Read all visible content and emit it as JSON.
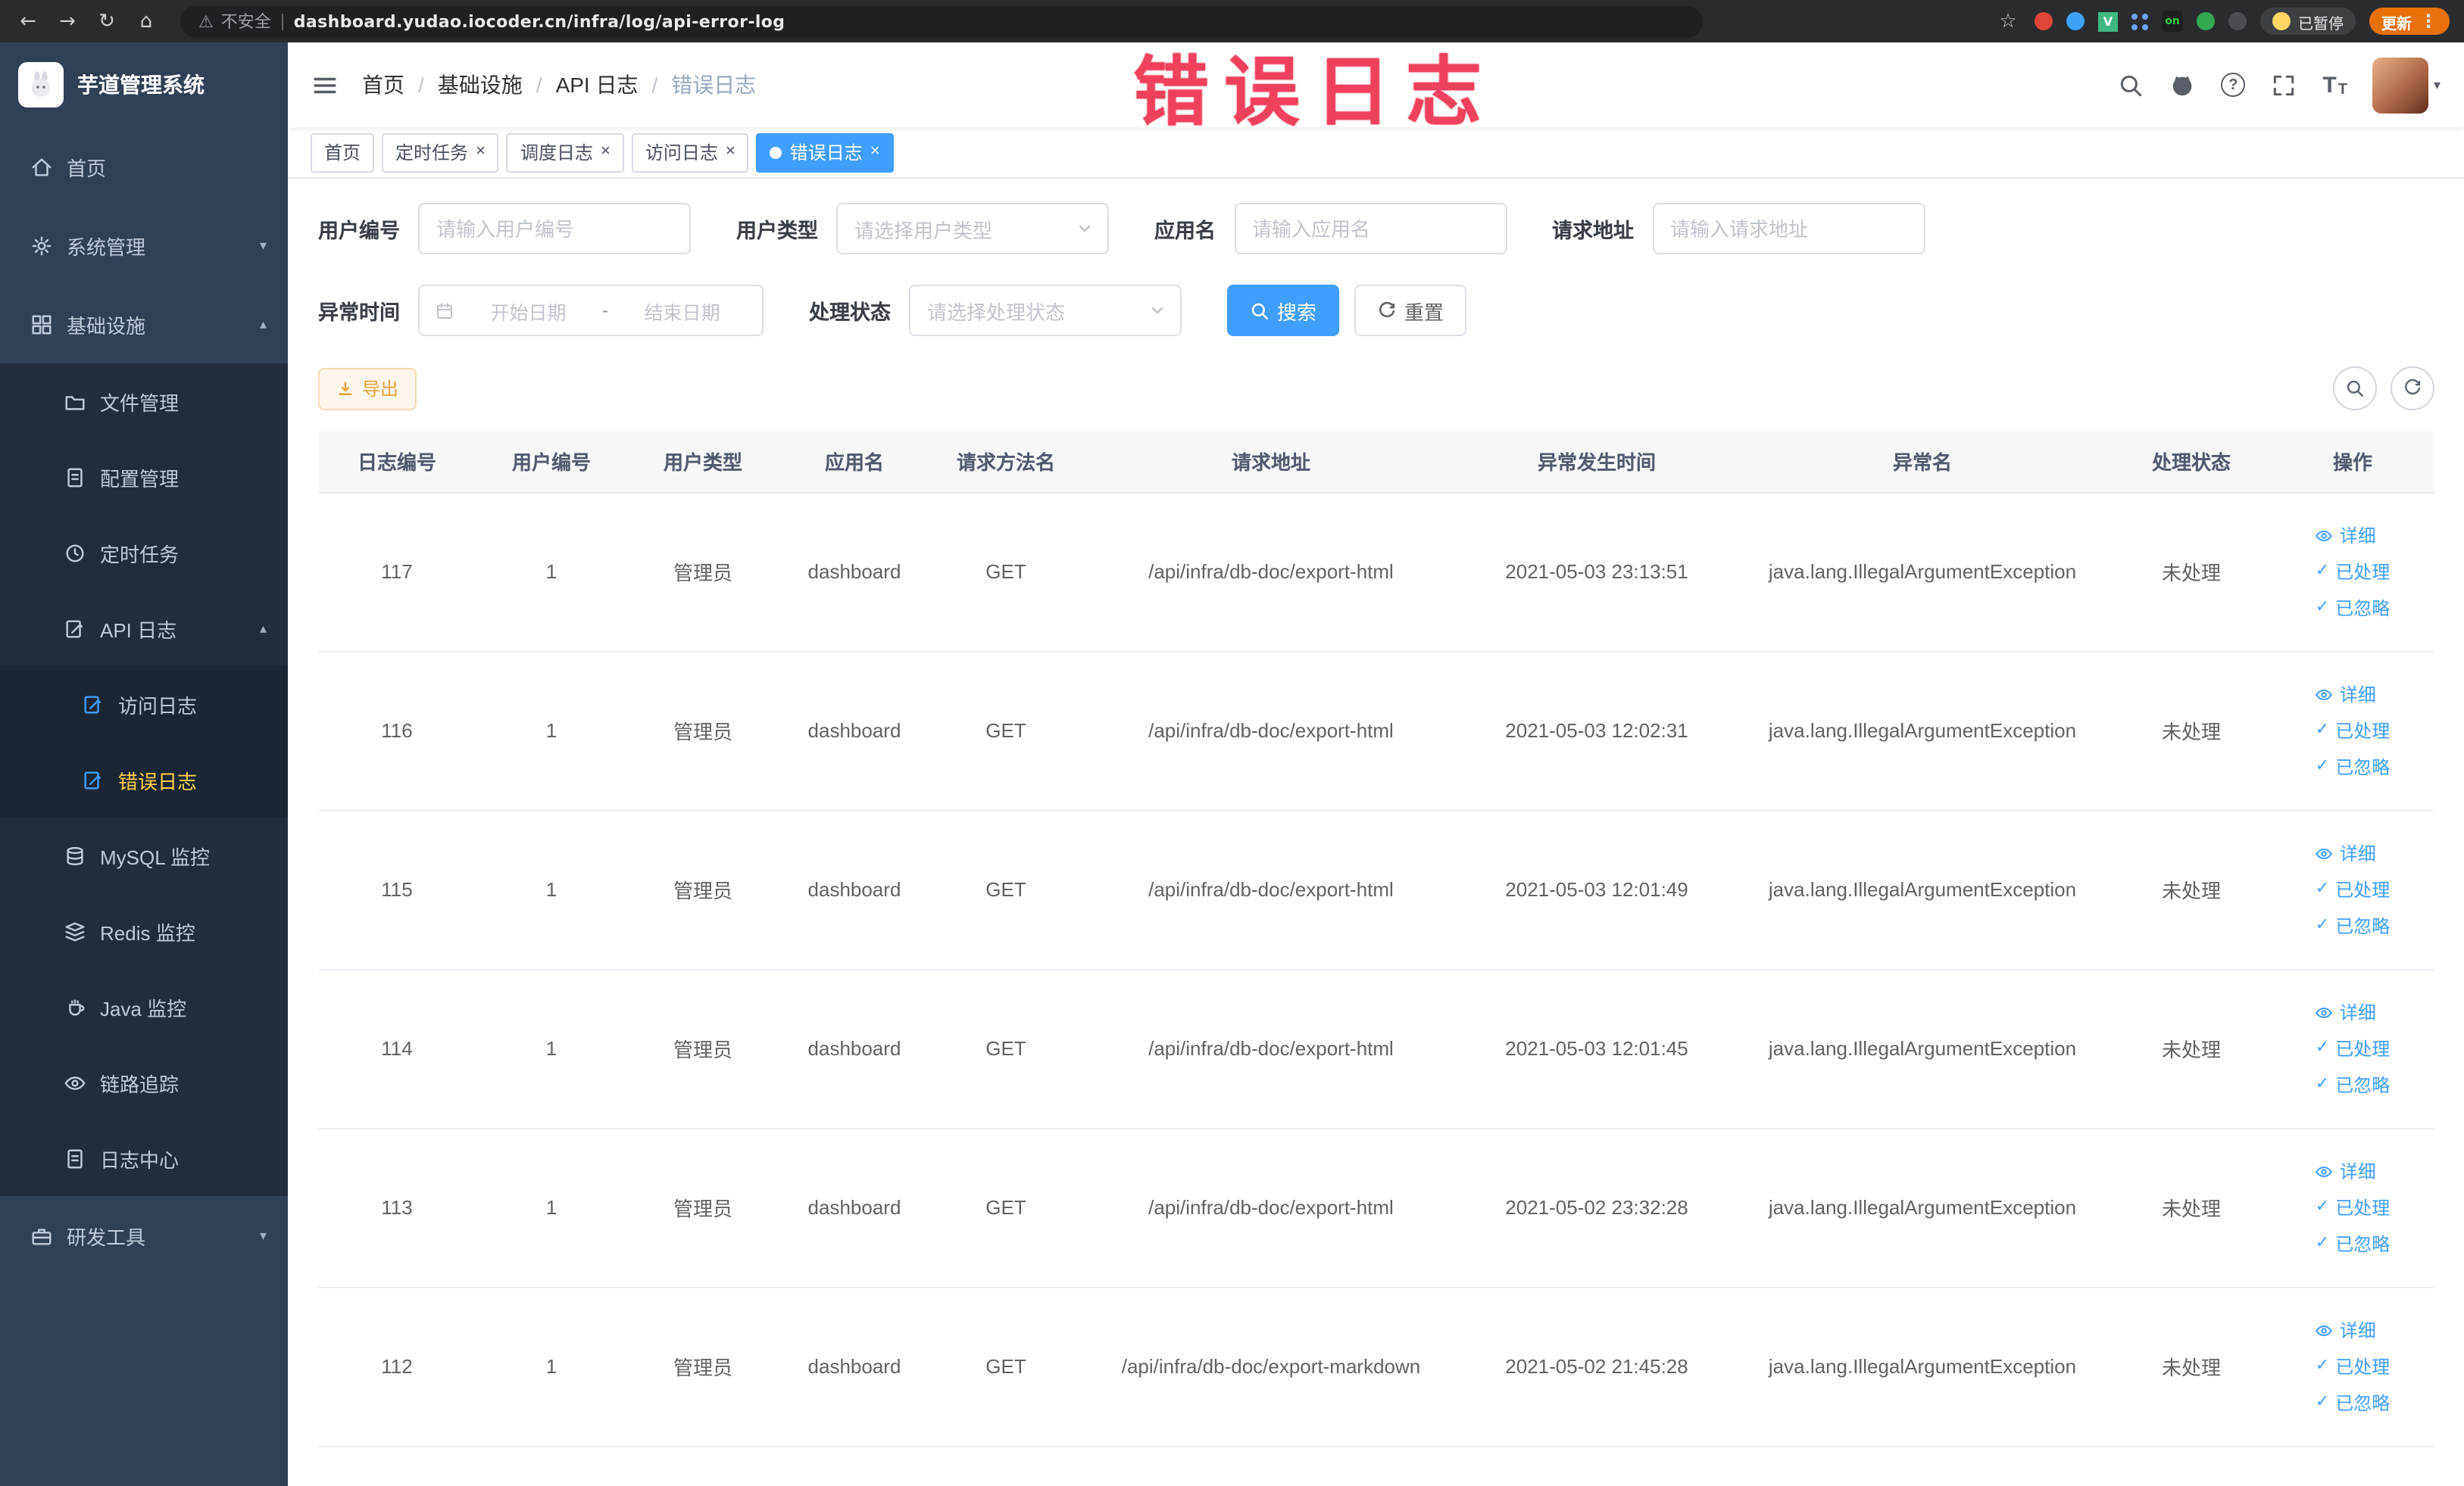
{
  "colors": {
    "accent": "#409eff",
    "sidebar_bg": "#304156",
    "sidebar_active_text": "#ffd04b",
    "annotation_red": "#ef415e",
    "warning": "#e6a23c",
    "tag_active_bg": "#409eff"
  },
  "icons": {
    "back": "←",
    "forward": "→",
    "reload": "↻",
    "home": "⌂",
    "star": "☆",
    "warning": "⚠",
    "kebab": "⋮",
    "caret_down": "▾",
    "tri_up": "▴",
    "tri_down": "▾",
    "slash": "/",
    "close": "×",
    "check": "✓",
    "help": "?",
    "font_size": "T",
    "vue_badge": "V",
    "on_badge": "on",
    "active_dot": "●"
  },
  "browser": {
    "security_label": "不安全",
    "url": "dashboard.yudao.iocoder.cn/infra/log/api-error-log",
    "paused_label": "已暂停",
    "update_label": "更新"
  },
  "annotation": {
    "text": "错误日志"
  },
  "app": {
    "title": "芋道管理系统"
  },
  "sidebar": {
    "items": [
      {
        "label": "首页"
      },
      {
        "label": "系统管理"
      },
      {
        "label": "基础设施",
        "children": [
          {
            "label": "文件管理"
          },
          {
            "label": "配置管理"
          },
          {
            "label": "定时任务"
          },
          {
            "label": "API 日志",
            "children": [
              {
                "label": "访问日志"
              },
              {
                "label": "错误日志"
              }
            ]
          },
          {
            "label": "MySQL 监控"
          },
          {
            "label": "Redis 监控"
          },
          {
            "label": "Java 监控"
          },
          {
            "label": "链路追踪"
          },
          {
            "label": "日志中心"
          }
        ]
      },
      {
        "label": "研发工具"
      }
    ]
  },
  "header": {
    "breadcrumb": [
      "首页",
      "基础设施",
      "API 日志",
      "错误日志"
    ]
  },
  "tabs": [
    {
      "label": "首页",
      "closable": false,
      "active": false
    },
    {
      "label": "定时任务",
      "closable": true,
      "active": false
    },
    {
      "label": "调度日志",
      "closable": true,
      "active": false
    },
    {
      "label": "访问日志",
      "closable": true,
      "active": false
    },
    {
      "label": "错误日志",
      "closable": true,
      "active": true
    }
  ],
  "filter": {
    "user_id": {
      "label": "用户编号",
      "placeholder": "请输入用户编号"
    },
    "user_type": {
      "label": "用户类型",
      "placeholder": "请选择用户类型"
    },
    "app_name": {
      "label": "应用名",
      "placeholder": "请输入应用名"
    },
    "request_url": {
      "label": "请求地址",
      "placeholder": "请输入请求地址"
    },
    "exception_time": {
      "label": "异常时间",
      "start_placeholder": "开始日期",
      "separator": "-",
      "end_placeholder": "结束日期"
    },
    "process_status": {
      "label": "处理状态",
      "placeholder": "请选择处理状态"
    },
    "search_button": "搜索",
    "reset_button": "重置"
  },
  "toolbar": {
    "export_button": "导出"
  },
  "table": {
    "headers": [
      "日志编号",
      "用户编号",
      "用户类型",
      "应用名",
      "请求方法名",
      "请求地址",
      "异常发生时间",
      "异常名",
      "处理状态",
      "操作"
    ],
    "actions": {
      "detail": "详细",
      "processed": "已处理",
      "ignored": "已忽略"
    },
    "rows": [
      {
        "id": "117",
        "user_id": "1",
        "user_type": "管理员",
        "app_name": "dashboard",
        "method": "GET",
        "url": "/api/infra/db-doc/export-html",
        "time": "2021-05-03 23:13:51",
        "exception": "java.lang.IllegalArgumentException",
        "status": "未处理"
      },
      {
        "id": "116",
        "user_id": "1",
        "user_type": "管理员",
        "app_name": "dashboard",
        "method": "GET",
        "url": "/api/infra/db-doc/export-html",
        "time": "2021-05-03 12:02:31",
        "exception": "java.lang.IllegalArgumentException",
        "status": "未处理"
      },
      {
        "id": "115",
        "user_id": "1",
        "user_type": "管理员",
        "app_name": "dashboard",
        "method": "GET",
        "url": "/api/infra/db-doc/export-html",
        "time": "2021-05-03 12:01:49",
        "exception": "java.lang.IllegalArgumentException",
        "status": "未处理"
      },
      {
        "id": "114",
        "user_id": "1",
        "user_type": "管理员",
        "app_name": "dashboard",
        "method": "GET",
        "url": "/api/infra/db-doc/export-html",
        "time": "2021-05-03 12:01:45",
        "exception": "java.lang.IllegalArgumentException",
        "status": "未处理"
      },
      {
        "id": "113",
        "user_id": "1",
        "user_type": "管理员",
        "app_name": "dashboard",
        "method": "GET",
        "url": "/api/infra/db-doc/export-html",
        "time": "2021-05-02 23:32:28",
        "exception": "java.lang.IllegalArgumentException",
        "status": "未处理"
      },
      {
        "id": "112",
        "user_id": "1",
        "user_type": "管理员",
        "app_name": "dashboard",
        "method": "GET",
        "url": "/api/infra/db-doc/export-markdown",
        "time": "2021-05-02 21:45:28",
        "exception": "java.lang.IllegalArgumentException",
        "status": "未处理"
      }
    ]
  }
}
